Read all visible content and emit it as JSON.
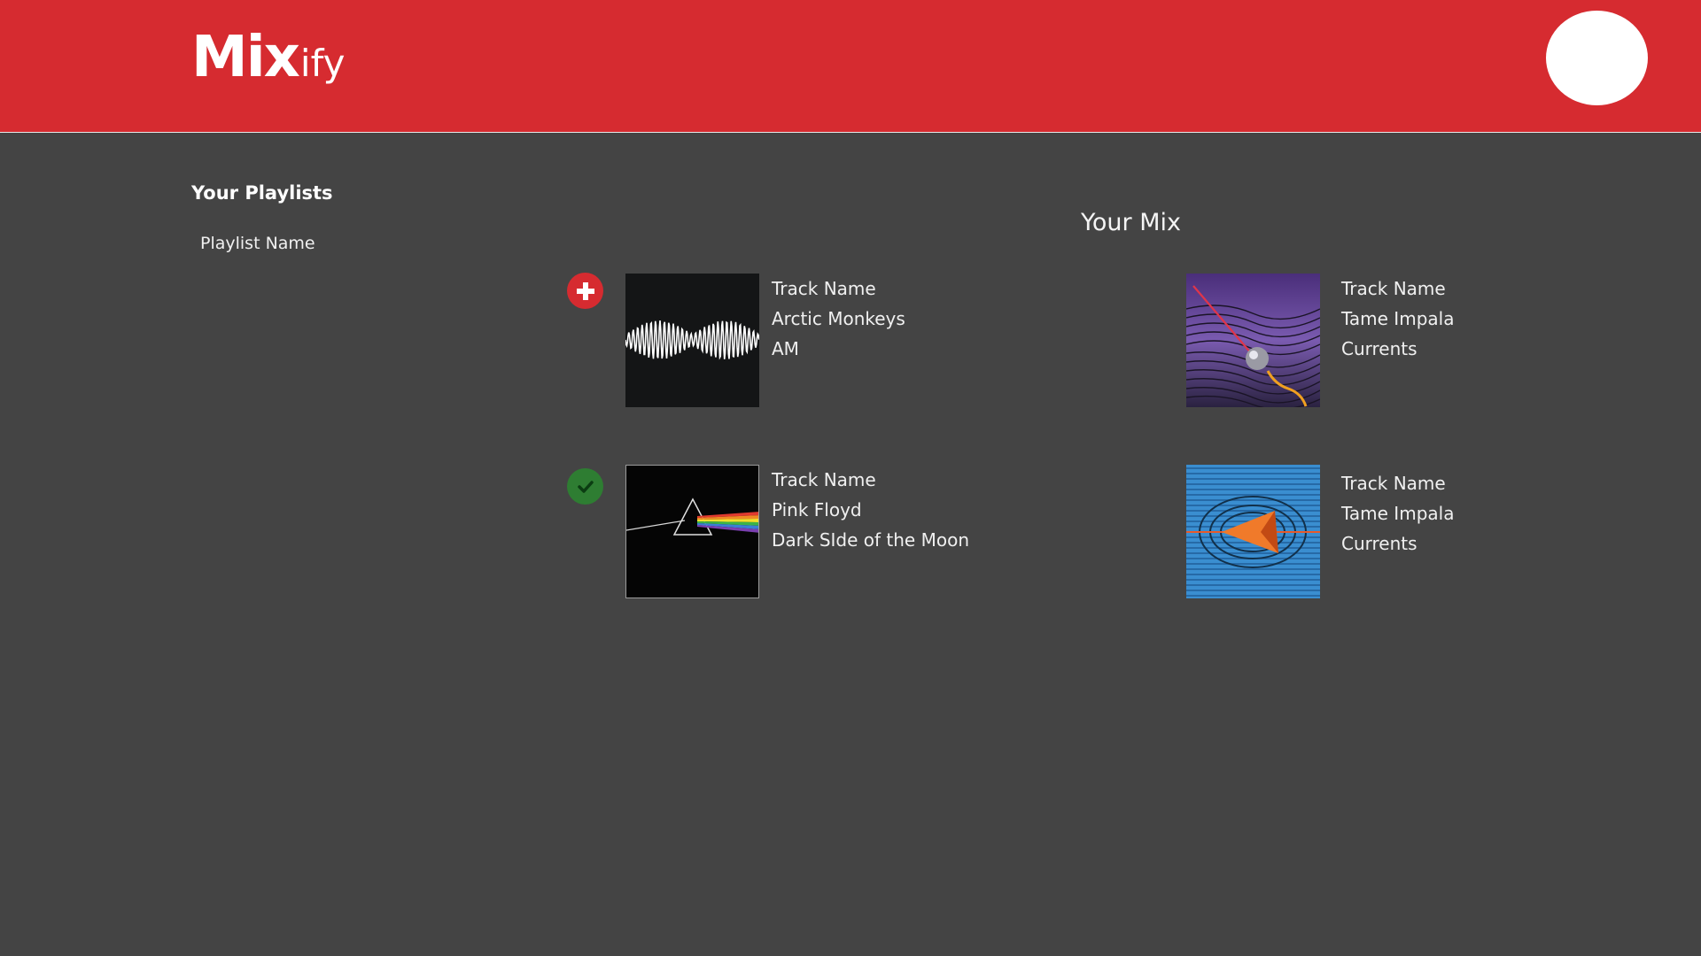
{
  "app": {
    "logo_bold": "Mix",
    "logo_light": "ify",
    "colors": {
      "header": "#d62b30",
      "background": "#444444",
      "add": "#d62b30",
      "added": "#2e7d32"
    }
  },
  "sidebar": {
    "title": "Your Playlists",
    "items": [
      {
        "label": "Playlist Name"
      }
    ]
  },
  "mix": {
    "title": "Your Mix",
    "tracks": [
      {
        "name": "Track Name",
        "artist": "Arctic Monkeys",
        "album": "AM",
        "status_icon": "plus-icon"
      },
      {
        "name": "Track Name",
        "artist": "Pink Floyd",
        "album": "Dark SIde of the Moon",
        "status_icon": "check-icon"
      },
      {
        "name": "Track Name",
        "artist": "Tame Impala",
        "album": "Currents"
      },
      {
        "name": "Track Name",
        "artist": "Tame Impala",
        "album": "Currents"
      }
    ]
  }
}
